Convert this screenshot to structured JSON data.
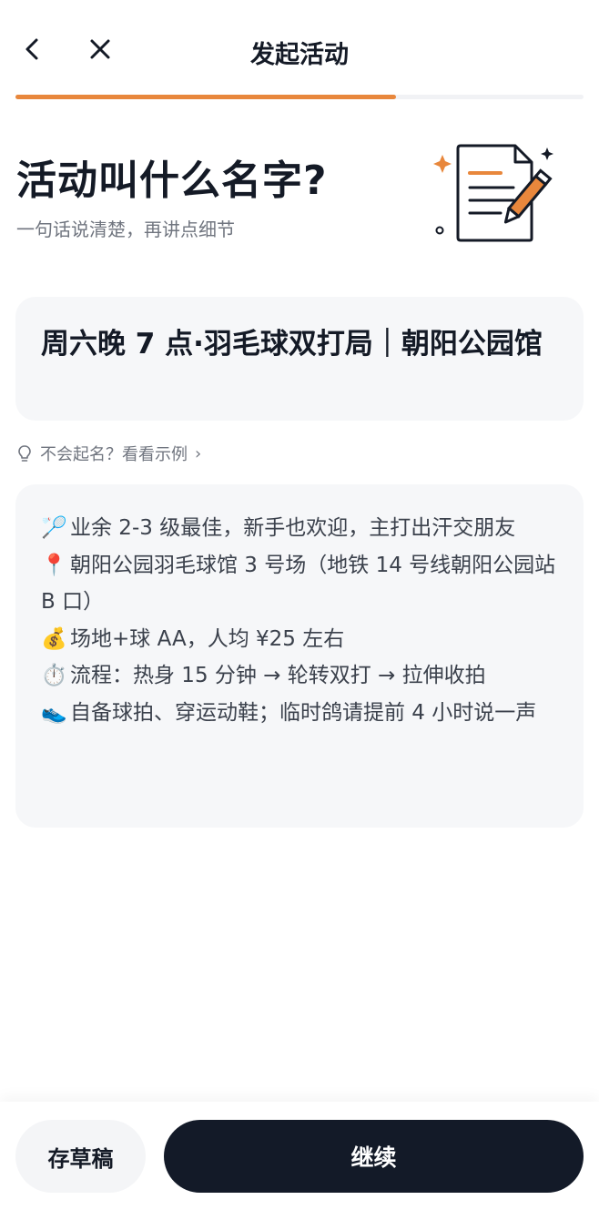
{
  "header": {
    "title": "发起活动",
    "back_icon": "chevron-left-icon",
    "close_icon": "close-icon"
  },
  "progress": {
    "fraction": 0.67,
    "color": "#e8873c"
  },
  "hero": {
    "title": "活动叫什么名字?",
    "subtitle": "一句话说清楚，再讲点细节",
    "illustration_icon": "document-pencil-icon"
  },
  "activity_name": {
    "value": "周六晚 7 点·羽毛球双打局｜朝阳公园馆"
  },
  "hint": {
    "icon": "lightbulb-icon",
    "text": "不会起名？看看示例"
  },
  "description": {
    "lines": [
      {
        "emoji": "🏸",
        "text": "业余 2-3 级最佳，新手也欢迎，主打出汗交朋友"
      },
      {
        "emoji": "📍",
        "text": "朝阳公园羽毛球馆 3 号场（地铁 14 号线朝阳公园站 B 口）"
      },
      {
        "emoji": "💰",
        "text": "场地+球 AA，人均 ¥25 左右"
      },
      {
        "emoji": "⏱️",
        "text": "流程：热身 15 分钟 → 轮转双打 → 拉伸收拍"
      },
      {
        "emoji": "👟",
        "text": "自备球拍、穿运动鞋；临时鸽请提前 4 小时说一声"
      }
    ]
  },
  "footer": {
    "draft_label": "存草稿",
    "continue_label": "继续"
  },
  "colors": {
    "accent": "#e8873c",
    "primary_dark": "#131a28",
    "card_bg": "#f6f7f9"
  }
}
